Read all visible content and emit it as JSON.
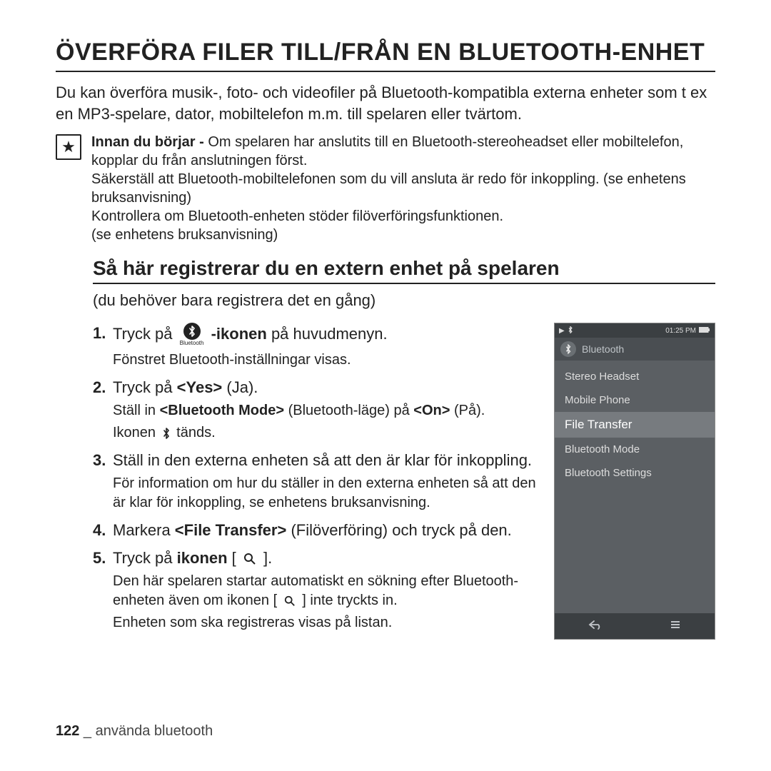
{
  "title": "ÖVERFÖRA FILER TILL/FRÅN EN BLUETOOTH-ENHET",
  "intro": "Du kan överföra musik-, foto- och videofiler på Bluetooth-kompatibla externa enheter som t ex en MP3-spelare, dator, mobiltelefon m.m. till spelaren eller tvärtom.",
  "note": {
    "lead_bold": "Innan du börjar -",
    "lead_rest": " Om spelaren har anslutits till en Bluetooth-stereoheadset eller mobiltelefon, kopplar du från anslutningen först.",
    "l2": "Säkerställ att Bluetooth-mobiltelefonen som du vill ansluta är redo för inkoppling. (se enhetens bruksanvisning)",
    "l3": "Kontrollera om Bluetooth-enheten stöder filöverföringsfunktionen.",
    "l4": "(se enhetens bruksanvisning)"
  },
  "subtitle": "Så här registrerar du en extern enhet på spelaren",
  "subintro": "(du behöver bara registrera det en gång)",
  "steps": {
    "s1": {
      "pre": "Tryck på ",
      "icon_label": "Bluetooth",
      "post_bold": "-ikonen",
      "post": " på huvudmenyn.",
      "sub": "Fönstret Bluetooth-inställningar visas."
    },
    "s2": {
      "text_pre": "Tryck på ",
      "text_bold": "<Yes>",
      "text_post": " (Ja).",
      "sub_pre": "Ställ in ",
      "sub_bold": "<Bluetooth Mode>",
      "sub_mid": " (Bluetooth-läge) på ",
      "sub_bold2": "<On>",
      "sub_post": " (På).",
      "sub2_pre": "Ikonen ",
      "sub2_post": " tänds."
    },
    "s3": {
      "text": "Ställ in den externa enheten så att den är klar för inkoppling.",
      "sub": "För information om hur du ställer in den externa enheten så att den är klar för inkoppling, se enhetens bruksanvisning."
    },
    "s4": {
      "pre": "Markera ",
      "bold": "<File Transfer>",
      "post": " (Filöverföring) och tryck på den."
    },
    "s5": {
      "pre": "Tryck på ",
      "bold": "ikonen",
      "post_pre": " [ ",
      "post_post": " ].",
      "sub_pre": "Den här spelaren startar automatiskt en sökning efter Bluetooth-enheten även om ikonen [ ",
      "sub_post": " ] inte tryckts in.",
      "sub2": "Enheten som ska registreras visas på listan."
    }
  },
  "device": {
    "time": "01:25 PM",
    "crumb": "Bluetooth",
    "items": [
      "Stereo Headset",
      "Mobile Phone",
      "File Transfer",
      "Bluetooth Mode",
      "Bluetooth Settings"
    ],
    "selected_index": 2
  },
  "footer": {
    "page": "122",
    "sep": " _ ",
    "section": "använda bluetooth"
  }
}
